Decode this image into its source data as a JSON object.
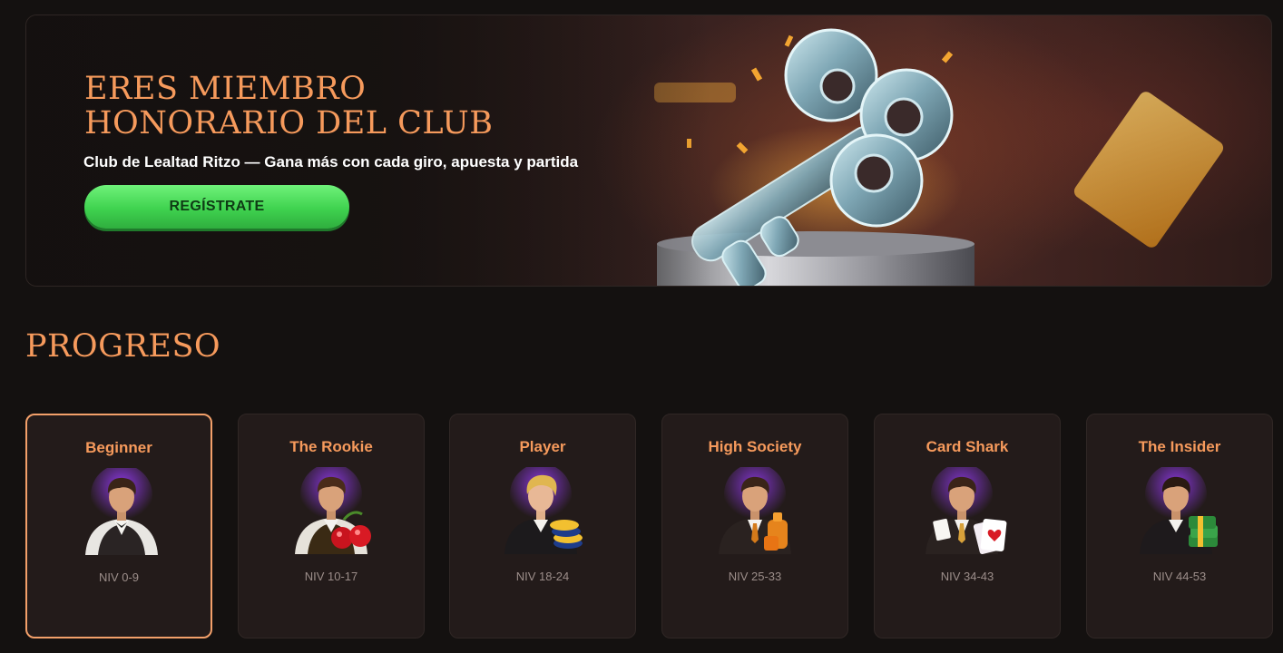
{
  "hero": {
    "title": "ERES MIEMBRO HONORARIO DEL CLUB",
    "subtitle": "Club de Lealtad Ritzo — Gana más con cada giro, apuesta y partida",
    "cta_label": "REGÍSTRATE"
  },
  "progress": {
    "title": "PROGRESO",
    "levels": [
      {
        "name": "Beginner",
        "range": "NIV 0-9",
        "active": true,
        "item": "none"
      },
      {
        "name": "The Rookie",
        "range": "NIV 10-17",
        "active": false,
        "item": "cherries"
      },
      {
        "name": "Player",
        "range": "NIV 18-24",
        "active": false,
        "item": "chips"
      },
      {
        "name": "High Society",
        "range": "NIV 25-33",
        "active": false,
        "item": "whiskey"
      },
      {
        "name": "Card Shark",
        "range": "NIV 34-43",
        "active": false,
        "item": "cards"
      },
      {
        "name": "The Insider",
        "range": "NIV 44-53",
        "active": false,
        "item": "cash"
      }
    ]
  },
  "colors": {
    "accent": "#f69a5c",
    "cta_green": "#3fd24f",
    "card_bg": "#231b1a",
    "page_bg": "#141110"
  }
}
